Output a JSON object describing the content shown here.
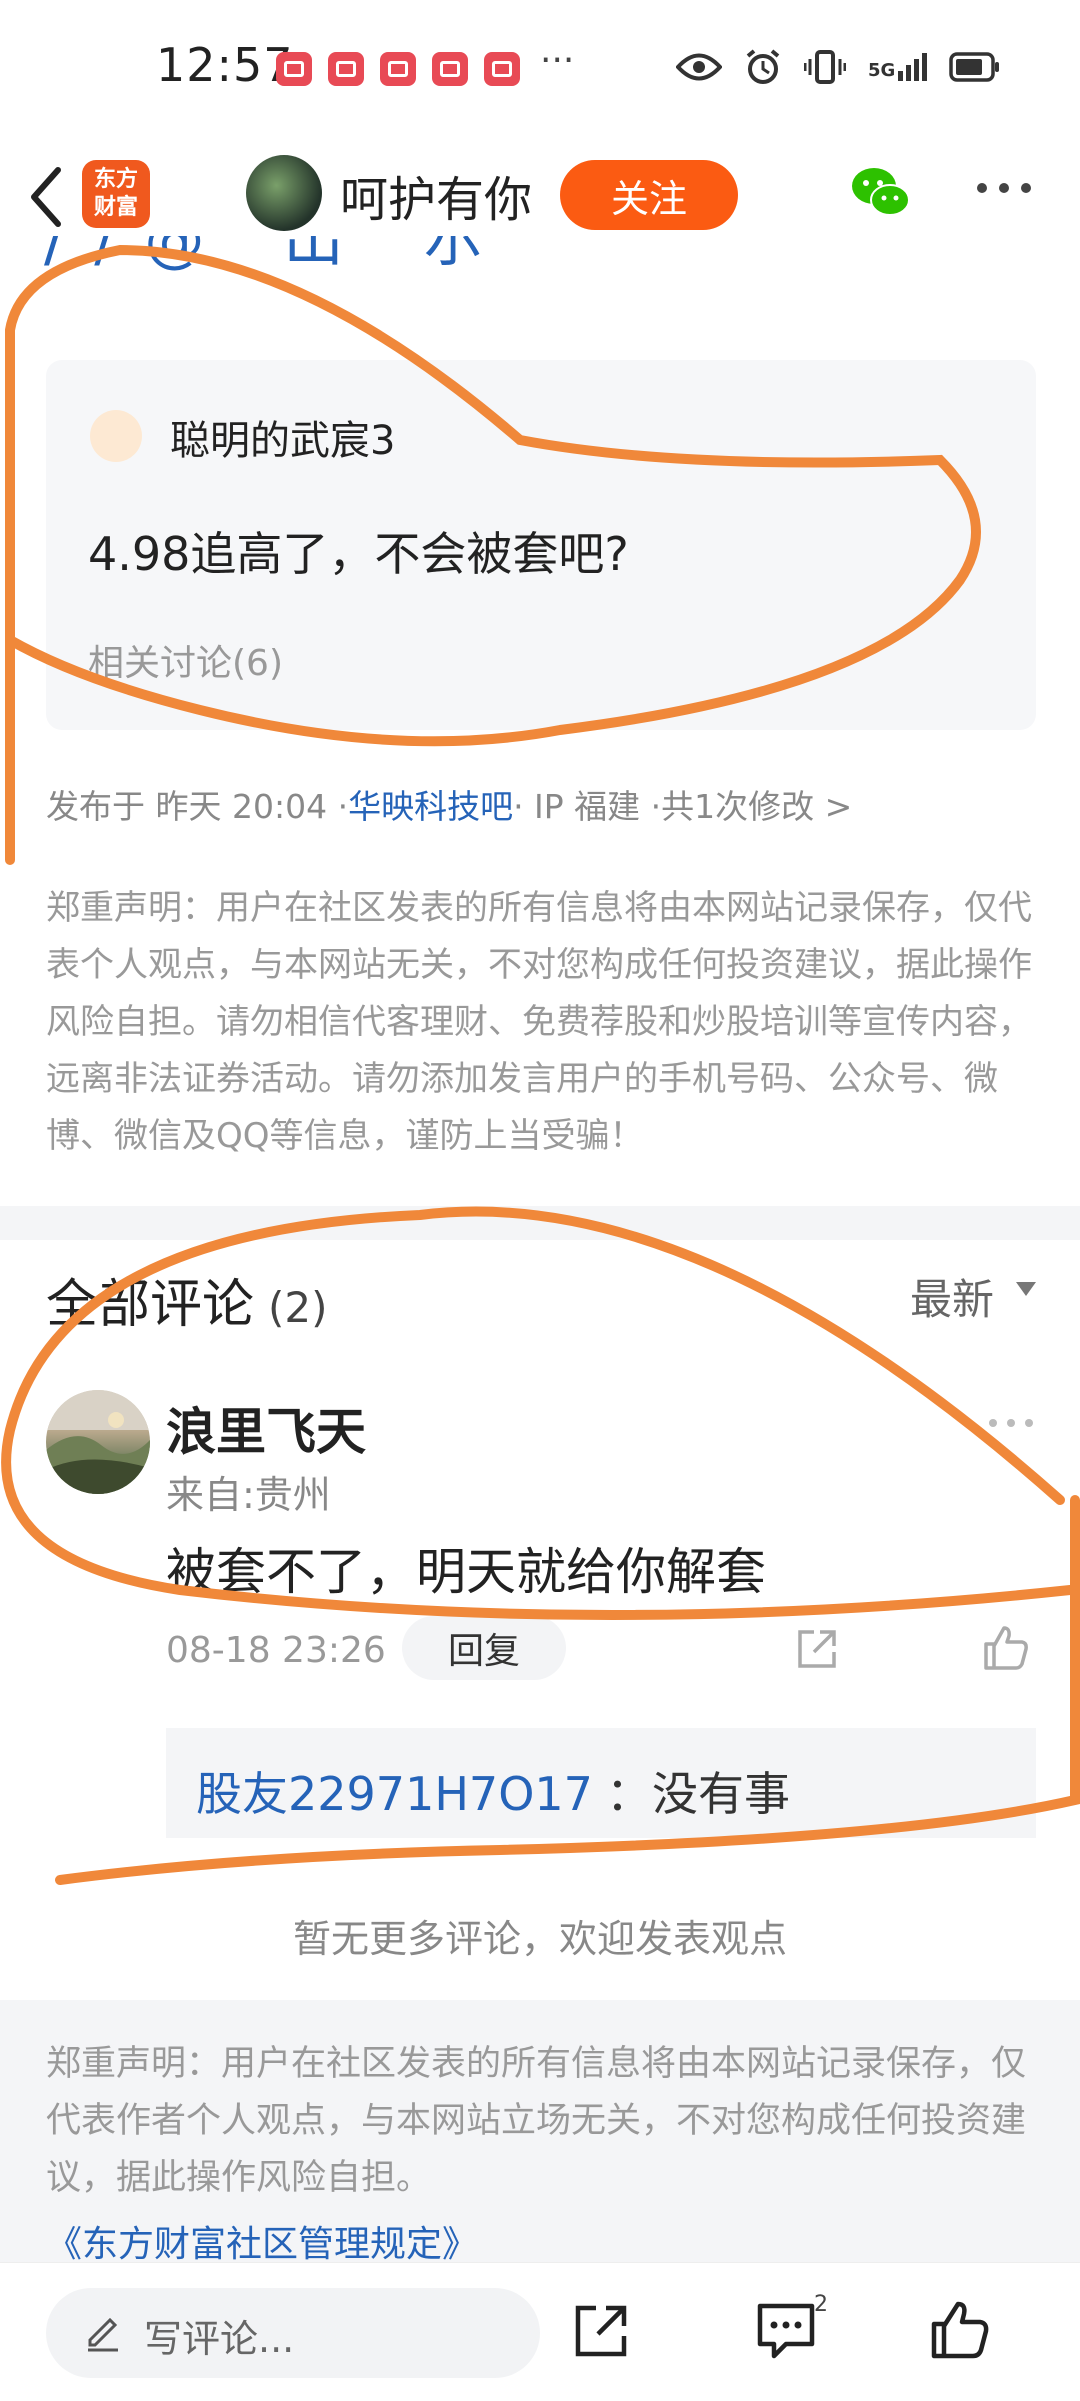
{
  "status_bar": {
    "time": "12:57",
    "more": "···",
    "network": "5G"
  },
  "header": {
    "app_logo": "东方\n财富",
    "user_name": "呵护有你",
    "follow_label": "关注"
  },
  "partial_text": "//@ 出 尔",
  "quote_card": {
    "author": "聪明的武宸3",
    "text": "4.98追高了，不会被套吧?",
    "related": "相关讨论(6)"
  },
  "post_meta": {
    "published": "发布于 昨天 20:04 · ",
    "bar_link": "华映科技吧",
    "ip": " · IP 福建 · ",
    "edits": "共1次修改 >"
  },
  "disclaimer_top": "郑重声明：用户在社区发表的所有信息将由本网站记录保存，仅代表个人观点，与本网站无关，不对您构成任何投资建议，据此操作风险自担。请勿相信代客理财、免费荐股和炒股培训等宣传内容，远离非法证券活动。请勿添加发言用户的手机号码、公众号、微博、微信及QQ等信息，谨防上当受骗！",
  "comments": {
    "title": "全部评论",
    "count": "(2)",
    "sort": "最新",
    "item": {
      "user": "浪里飞天",
      "location": "来自:贵州",
      "body": "被套不了，明天就给你解套",
      "time": "08-18 23:26",
      "reply_label": "回复",
      "reply": {
        "user": "股友22971H7O17",
        "text": "：没有事"
      }
    },
    "no_more": "暂无更多评论，欢迎发表观点"
  },
  "disclaimer_bottom": "郑重声明：用户在社区发表的所有信息将由本网站记录保存，仅代表作者个人观点，与本网站立场无关，不对您构成任何投资建议，据此操作风险自担。",
  "rules_link": "《东方财富社区管理规定》",
  "bottom_bar": {
    "placeholder": "写评论...",
    "comment_count": "2"
  },
  "colors": {
    "accent": "#fb5b12",
    "link": "#2563b8",
    "annotation": "#f0883a"
  }
}
